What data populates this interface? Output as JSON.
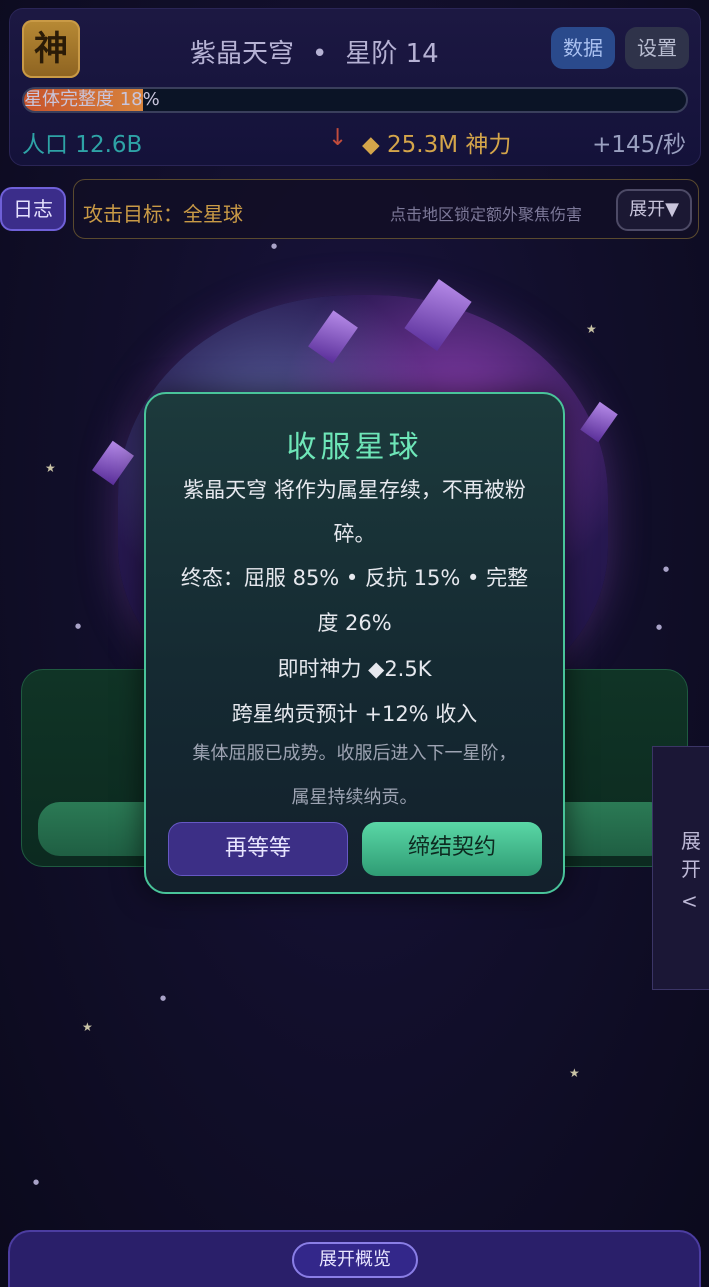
{
  "header": {
    "god_badge": "神",
    "planet_name": "紫晶天穹",
    "separator": "•",
    "tier": "星阶 14",
    "data_button": "数据",
    "settings_button": "设置",
    "integrity_label": "星体完整度 18%",
    "integrity_fraction": 0.18,
    "population": "人口 12.6B",
    "trend_arrow": "↓",
    "divine_power": "◆ 25.3M 神力",
    "income_rate": "+145/秒"
  },
  "attack_bar": {
    "log_button": "日志",
    "target": "攻击目标：全星球",
    "hint": "点击地区锁定额外聚焦伤害",
    "expand_button": "展开▼"
  },
  "side_tab": {
    "label": "展开",
    "chevron": "<"
  },
  "modal": {
    "title": "收服星球",
    "line1": "紫晶天穹 将作为属星存续，不再被粉",
    "line1b": "碎。",
    "line2": "终态：屈服 85% • 反抗 15% • 完整",
    "line2b": "度 26%",
    "line3": "即时神力 ◆2.5K",
    "line4": "跨星纳贡预计 +12% 收入",
    "line5": "集体屈服已成势。收服后进入下一星阶，",
    "line5b": "属星持续纳贡。",
    "wait_button": "再等等",
    "sign_button": "缔结契约"
  },
  "bottom_bar": {
    "overview_button": "展开概览"
  },
  "colors": {
    "accent_green": "#49c49a",
    "gold": "#d4a54a",
    "teal": "#2ea3a6",
    "purple": "#3b2d8a"
  }
}
